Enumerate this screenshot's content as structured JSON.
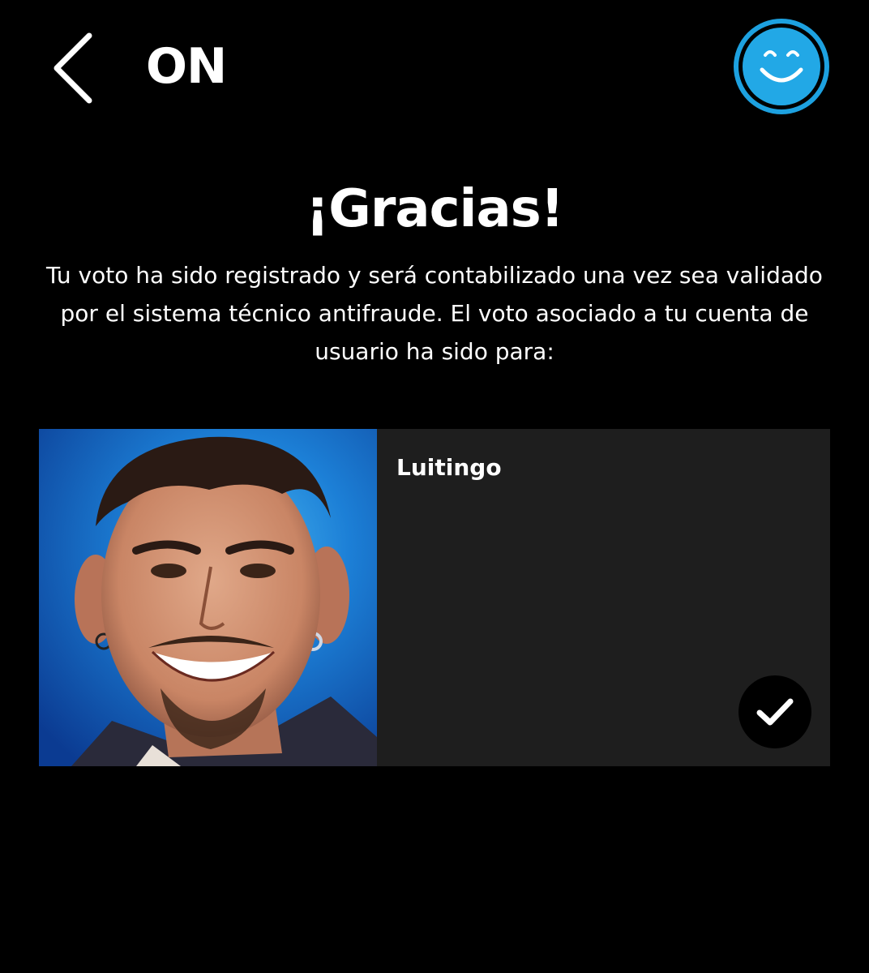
{
  "header": {
    "back_icon": "chevron-left-icon",
    "app_title": "ON",
    "profile_icon": "smiley-face-icon",
    "profile_ring_color": "#1da1e0",
    "profile_fill_color": "#22a8e6"
  },
  "confirmation": {
    "title": "¡Gracias!",
    "message": "Tu voto ha sido registrado y será contabilizado una vez sea validado por el sistema técnico antifraude. El voto asociado a tu cuenta de usuario ha sido para:"
  },
  "vote_card": {
    "candidate_name": "Luitingo",
    "photo_icon": "candidate-portrait",
    "selected_icon": "checkmark-icon",
    "card_color": "#1e1e1e"
  }
}
